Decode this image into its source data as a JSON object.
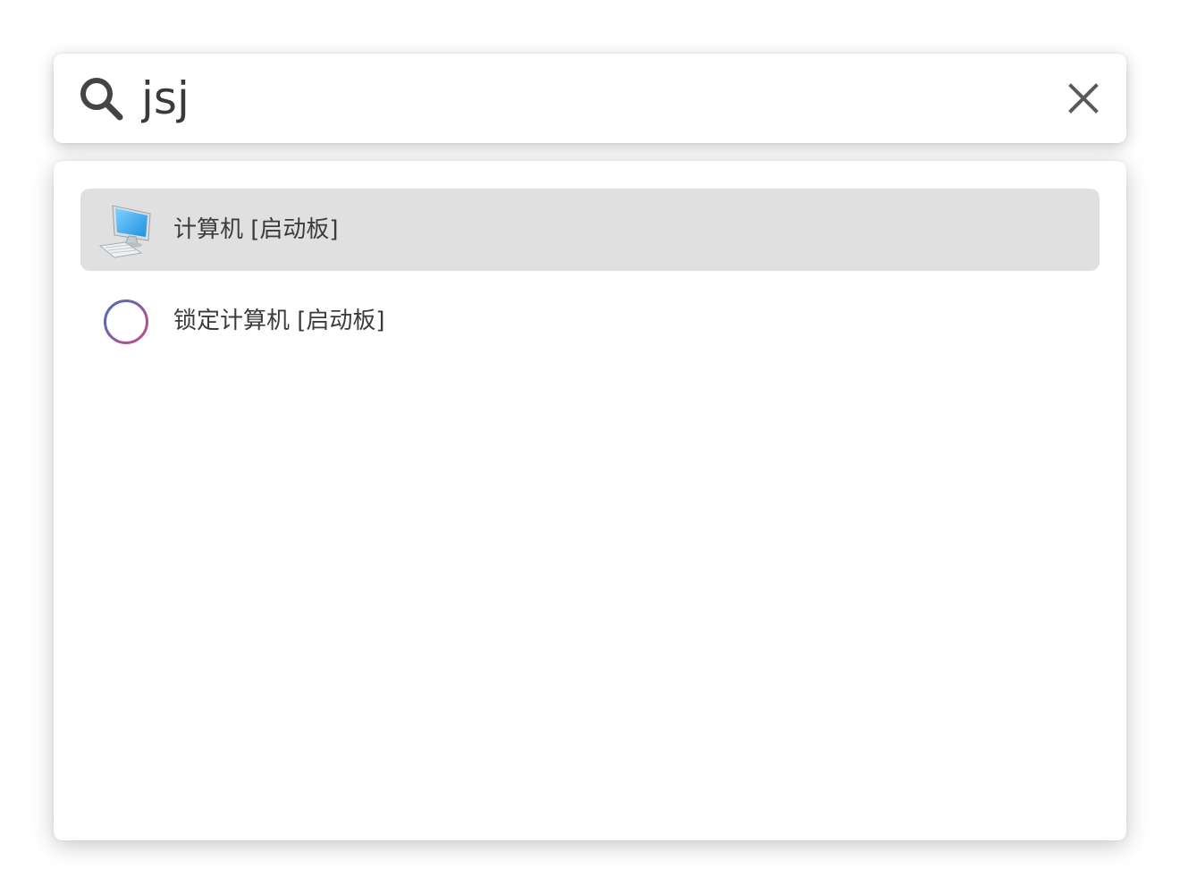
{
  "search": {
    "query": "jsj"
  },
  "results": [
    {
      "label": "计算机 [启动板]",
      "icon": "computer-icon",
      "selected": true
    },
    {
      "label": "锁定计算机 [启动板]",
      "icon": "circle-outline-icon",
      "selected": false
    }
  ],
  "colors": {
    "selected_background": "#e0e0e0",
    "text": "#3c3c3c",
    "icon_gray": "#555555",
    "screen_blue": "#29a8ef"
  }
}
